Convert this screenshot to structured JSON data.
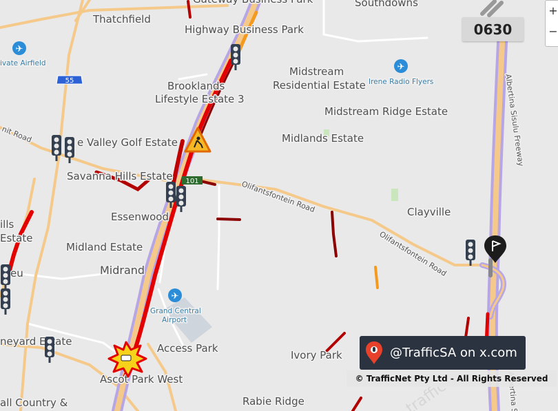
{
  "time": "0630",
  "social": {
    "handle": "@TrafficSA on x.com"
  },
  "copyright": "© TrafficNet Pty Ltd - All Rights Reserved",
  "zoom": {
    "in": "+",
    "out": "−"
  },
  "places": {
    "gateway": "Gateway Business Park",
    "southdowns": "Southdowns",
    "thatchfield": "Thatchfield",
    "highway": "Highway Business Park",
    "airfield": "ivate Airfield",
    "midstream": "Midstream",
    "midstream2": "Residential Estate",
    "irene": "Irene Radio Flyers",
    "brooklands": "Brooklands",
    "brooklands2": "Lifestyle Estate 3",
    "midstream_ridge": "Midstream Ridge Estate",
    "midlands": "Midlands Estate",
    "golf": "e Valley Golf Estate",
    "savanna": "Savanna Hills Estate",
    "essenwood": "Essenwood",
    "clayville": "Clayville",
    "hills": "ills",
    "estate_left": "Estate",
    "midland_estate": "Midland Estate",
    "midrand": "Midrand",
    "eu": "eu",
    "grand_central": "Grand Central",
    "airport": "Airport",
    "neyard": "neyard Estate",
    "access_park": "Access Park",
    "ivory_park": "Ivory Park",
    "ascot": "Ascot Park West",
    "country": "all Country &",
    "rabie": "Rabie Ridge",
    "mt_road": "nit Road",
    "olif1": "Olifantsfontein Road",
    "olif2": "Olifantsfontein Road",
    "albertina": "Albertina Sisulu Freeway",
    "albertina2": "Albertina Sisulu",
    "hwy55": "55",
    "exit_sign": "101"
  },
  "colors": {
    "background": "#e9e9e9",
    "highway": "#b7a6e6",
    "major_road": "#f5c98a",
    "congestion_severe": "#8b0000",
    "congestion_heavy": "#e30000",
    "congestion_moderate": "#f49a1f",
    "social_bg": "#2b3340"
  },
  "icons": [
    "airport-icon",
    "traffic-light-icon",
    "roadworks-icon",
    "crash-icon",
    "flag-marker-icon",
    "location-pin-icon"
  ]
}
